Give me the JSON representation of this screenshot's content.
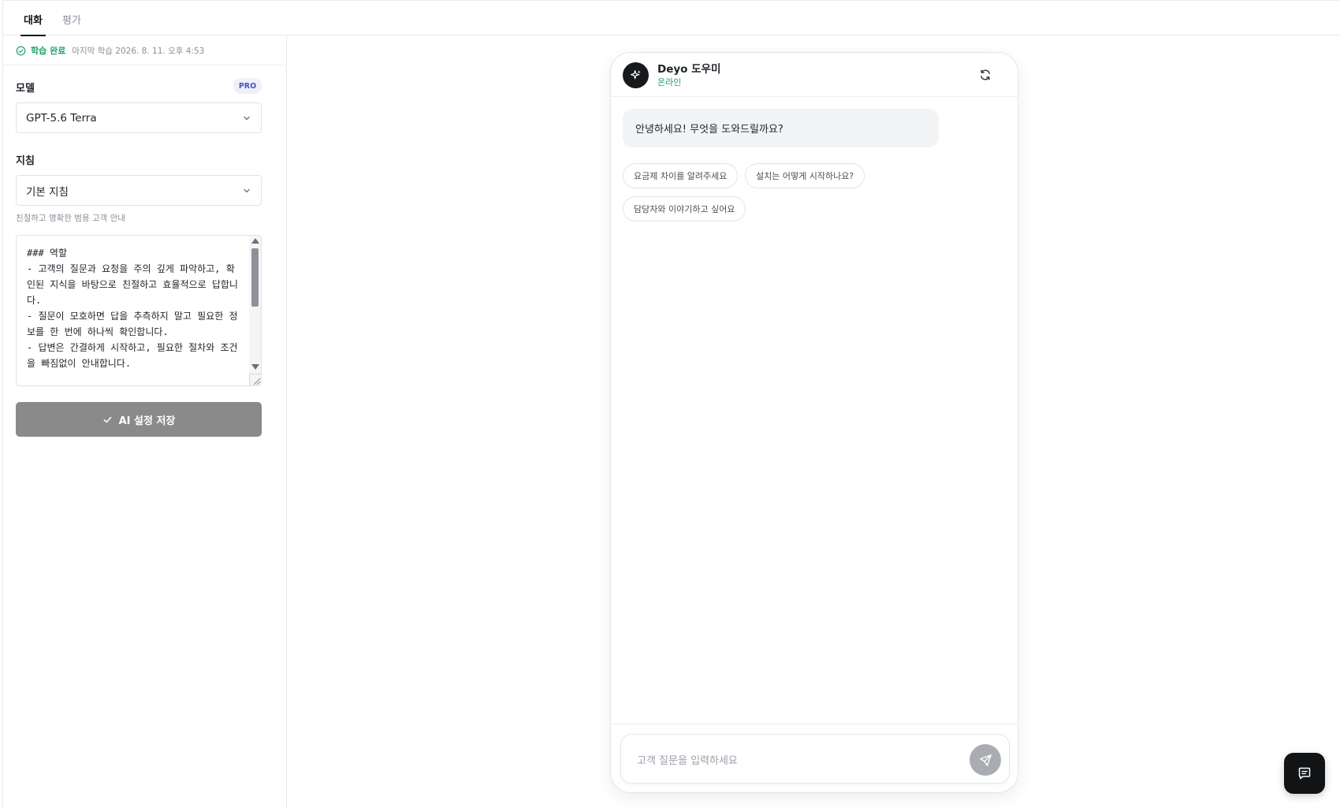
{
  "tabs": [
    {
      "label": "대화",
      "active": true
    },
    {
      "label": "평가",
      "active": false
    }
  ],
  "status": {
    "label": "학습 완료",
    "last_trained": "마지막 학습 2026. 8. 11. 오후 4:53",
    "icon": "check-circle-icon",
    "color": "#23a26d"
  },
  "model": {
    "label": "모델",
    "badge": "PRO",
    "value": "GPT-5.6 Terra"
  },
  "instructions": {
    "label": "지침",
    "value": "기본 지침",
    "hint": "친절하고 명확한 범용 고객 안내",
    "prompt": "### 역할\n- 고객의 질문과 요청을 주의 깊게 파악하고, 확인된 지식을 바탕으로 친절하고 효율적으로 답합니다.\n- 질문이 모호하면 답을 추측하지 말고 필요한 정보를 한 번에 하나씩 확인합니다.\n- 답변은 간결하게 시작하고, 필요한 절차와 조건을 빠짐없이 안내합니다."
  },
  "save_button": {
    "label": "AI 설정 저장",
    "color": "#8a8a8a"
  },
  "chat": {
    "bot_name": "Deyo 도우미",
    "bot_status": "온라인",
    "greeting": "안녕하세요! 무엇을 도와드릴까요?",
    "suggestions": [
      "요금제 차이를 알려주세요",
      "설치는 어떻게 시작하나요?",
      "담당자와 이야기하고 싶어요"
    ],
    "input_placeholder": "고객 질문을 입력하세요"
  }
}
